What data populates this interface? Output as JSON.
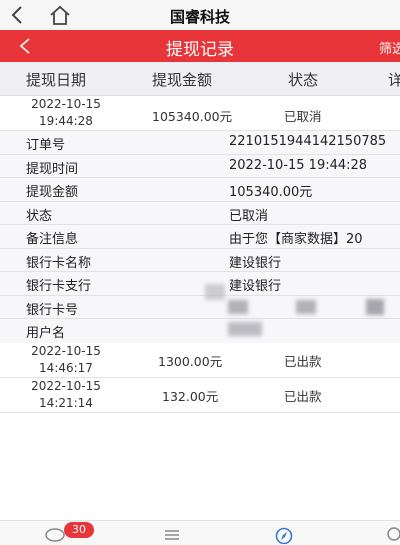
{
  "app": {
    "title": "国睿科技"
  },
  "header": {
    "title": "提现记录",
    "filter_label": "筛选"
  },
  "columns": [
    "提现日期",
    "提现金额",
    "状态",
    "详"
  ],
  "records": [
    {
      "date": "2022-10-15",
      "time": "19:44:28",
      "amount": "105340.00元",
      "status": "已取消"
    },
    {
      "date": "2022-10-15",
      "time": "14:46:17",
      "amount": "1300.00元",
      "status": "已出款"
    },
    {
      "date": "2022-10-15",
      "time": "14:21:14",
      "amount": "132.00元",
      "status": "已出款"
    }
  ],
  "detail": [
    {
      "label": "订单号",
      "value": "2210151944142150785"
    },
    {
      "label": "提现时间",
      "value": "2022-10-15 19:44:28"
    },
    {
      "label": "提现金额",
      "value": "105340.00元"
    },
    {
      "label": "状态",
      "value": "已取消"
    },
    {
      "label": "备注信息",
      "value": "由于您【商家数据】20"
    },
    {
      "label": "银行卡名称",
      "value": "建设银行"
    },
    {
      "label": "银行卡支行",
      "value": "建设银行"
    },
    {
      "label": "银行卡号",
      "value": ""
    },
    {
      "label": "用户名",
      "value": ""
    }
  ],
  "tabbar": {
    "message_count": "30"
  },
  "colors": {
    "accent": "#e8353a"
  }
}
